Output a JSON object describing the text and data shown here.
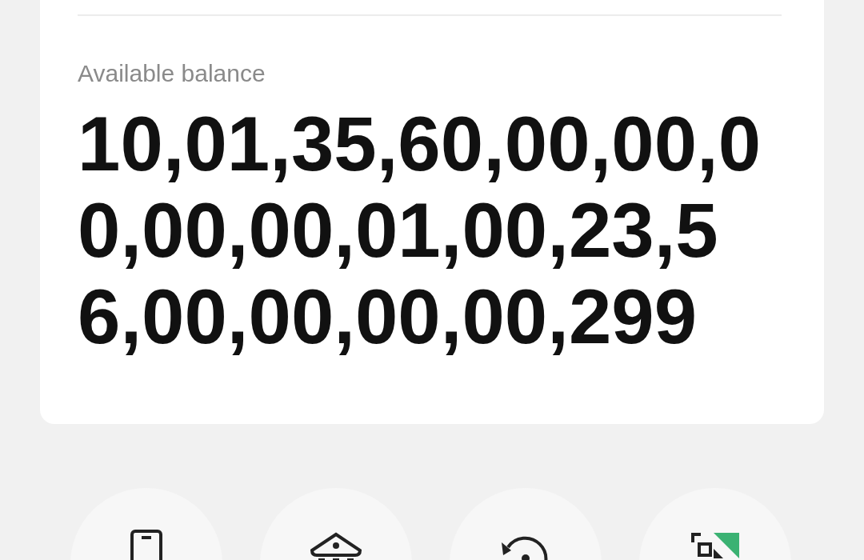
{
  "balance_card": {
    "label": "Available balance",
    "amount": "10,01,35,60,00,00,00,00,00,01,00,23,56,00,00,00,00,299"
  },
  "actions": [
    {
      "kind": "phone"
    },
    {
      "kind": "bank"
    },
    {
      "kind": "rotate"
    },
    {
      "kind": "scan"
    }
  ]
}
